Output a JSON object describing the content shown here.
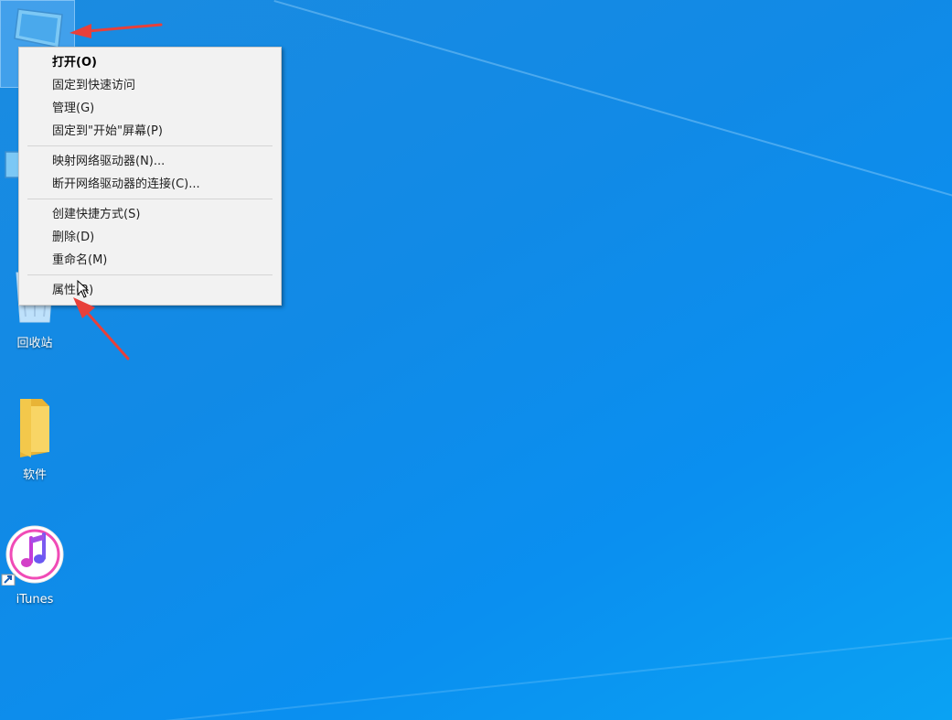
{
  "desktop": {
    "background_color": "#0f8ae8",
    "icons": [
      {
        "id": "this-pc",
        "label": "",
        "selected": true
      },
      {
        "id": "network",
        "label": ""
      },
      {
        "id": "recycle-bin",
        "label": "回收站"
      },
      {
        "id": "folder",
        "label": "软件"
      },
      {
        "id": "itunes",
        "label": "iTunes"
      }
    ]
  },
  "context_menu": {
    "items": [
      {
        "label": "打开(O)",
        "bold": true
      },
      {
        "label": "固定到快速访问"
      },
      {
        "label": "管理(G)"
      },
      {
        "label": "固定到\"开始\"屏幕(P)"
      },
      {
        "separator": true
      },
      {
        "label": "映射网络驱动器(N)..."
      },
      {
        "label": "断开网络驱动器的连接(C)..."
      },
      {
        "separator": true
      },
      {
        "label": "创建快捷方式(S)"
      },
      {
        "label": "删除(D)"
      },
      {
        "label": "重命名(M)"
      },
      {
        "separator": true
      },
      {
        "label": "属性(R)"
      }
    ]
  },
  "annotations": {
    "arrow_color": "#e8403a"
  }
}
